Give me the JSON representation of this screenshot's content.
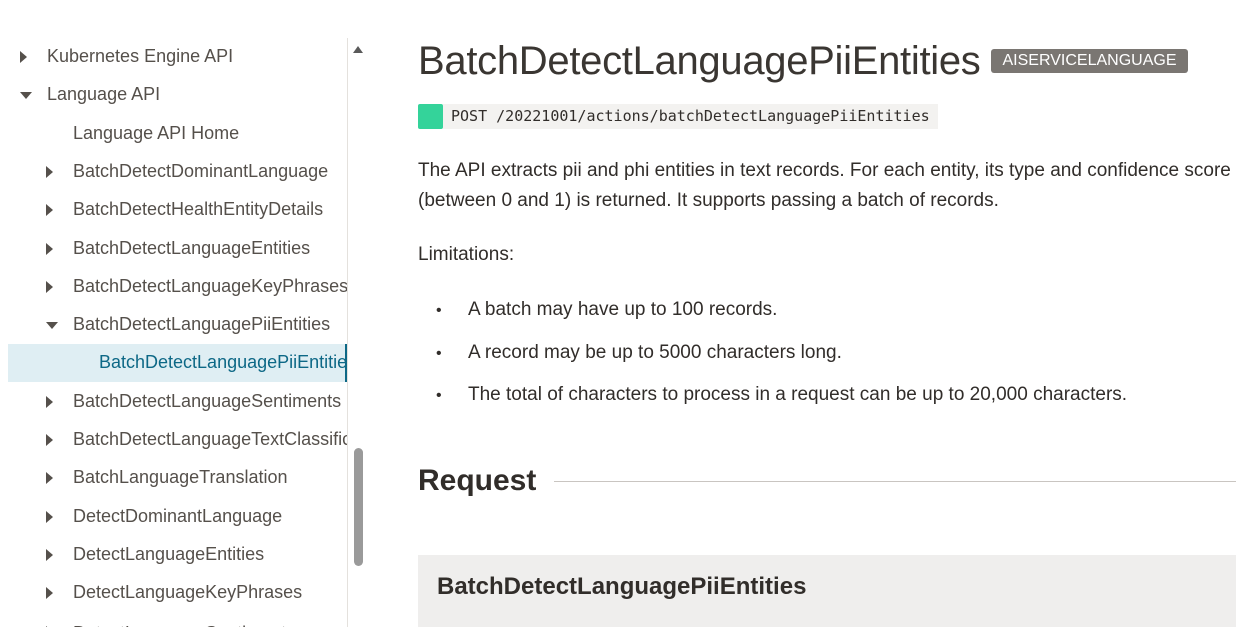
{
  "sidebar": {
    "items": [
      {
        "label": "Kubernetes Engine API",
        "level": 0,
        "caret": "right"
      },
      {
        "label": "Language API",
        "level": 0,
        "caret": "down"
      },
      {
        "label": "Language API Home",
        "level": 1,
        "caret": "none"
      },
      {
        "label": "BatchDetectDominantLanguage",
        "level": 1,
        "caret": "right"
      },
      {
        "label": "BatchDetectHealthEntityDetails",
        "level": 1,
        "caret": "right"
      },
      {
        "label": "BatchDetectLanguageEntities",
        "level": 1,
        "caret": "right"
      },
      {
        "label": "BatchDetectLanguageKeyPhrases",
        "level": 1,
        "caret": "right"
      },
      {
        "label": "BatchDetectLanguagePiiEntities",
        "level": 1,
        "caret": "down"
      },
      {
        "label": "BatchDetectLanguagePiiEntities",
        "level": 2,
        "caret": "none",
        "active": true
      },
      {
        "label": "BatchDetectLanguageSentiments",
        "level": 1,
        "caret": "right"
      },
      {
        "label": "BatchDetectLanguageTextClassification",
        "level": 1,
        "caret": "right"
      },
      {
        "label": "BatchLanguageTranslation",
        "level": 1,
        "caret": "right"
      },
      {
        "label": "DetectDominantLanguage",
        "level": 1,
        "caret": "right"
      },
      {
        "label": "DetectLanguageEntities",
        "level": 1,
        "caret": "right"
      },
      {
        "label": "DetectLanguageKeyPhrases",
        "level": 1,
        "caret": "right"
      },
      {
        "label": "DetectLanguageSentiments",
        "level": 1,
        "caret": "right",
        "partial": true
      }
    ]
  },
  "main": {
    "title": "BatchDetectLanguagePiiEntities",
    "badge": "AISERVICELANGUAGE",
    "endpoint": {
      "method": "POST",
      "path": "POST /20221001/actions/batchDetectLanguagePiiEntities",
      "method_color": "#34d39a"
    },
    "description": "The API extracts pii and phi entities in text records. For each entity, its type and confidence score (between 0 and 1) is returned. It supports passing a batch of records.",
    "limitations_label": "Limitations:",
    "limitations": [
      "A batch may have up to 100 records.",
      "A record may be up to 5000 characters long.",
      "The total of characters to process in a request can be up to 20,000 characters."
    ],
    "request_heading": "Request",
    "request_box_title": "BatchDetectLanguagePiiEntities"
  },
  "colors": {
    "active_bg": "#dfeef3",
    "active_text": "#0d6886",
    "badge_bg": "#7a7672"
  }
}
